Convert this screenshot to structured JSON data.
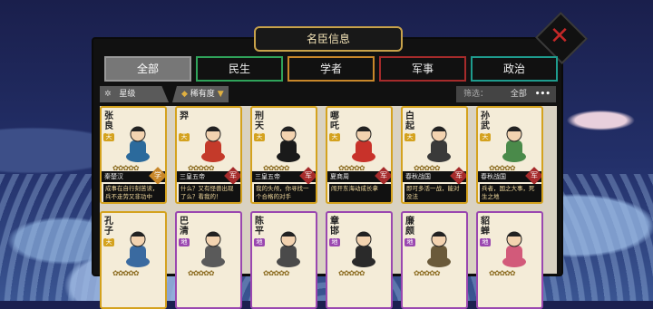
{
  "window": {
    "title": "名臣信息"
  },
  "tabs": [
    {
      "label": "全部",
      "color": "#999999",
      "active": true
    },
    {
      "label": "民生",
      "color": "#2fa35a",
      "active": false
    },
    {
      "label": "学者",
      "color": "#c8872a",
      "active": false
    },
    {
      "label": "军事",
      "color": "#a62b2b",
      "active": false
    },
    {
      "label": "政治",
      "color": "#1e9c8e",
      "active": false
    }
  ],
  "filter": {
    "sort_primary": "星级",
    "sort_secondary": "稀有度",
    "screen_label": "筛选：",
    "screen_value": "全部",
    "more_icon": "more-dots-icon"
  },
  "cards": [
    {
      "name": "张良",
      "badge": "天",
      "badge_color": "#d4a21e",
      "border": "#d4a21e",
      "stars": "✿✿✿✿✿",
      "origin": "秦楚汉",
      "role": "学",
      "role_color": "#c8872a",
      "quote": "成事在自行刻苦读，兵不走劳又非功中"
    },
    {
      "name": "羿",
      "badge": "天",
      "badge_color": "#d4a21e",
      "border": "#d4a21e",
      "stars": "✿✿✿✿✿",
      "origin": "三皇五帝",
      "role": "军",
      "role_color": "#a62b2b",
      "quote": "什么？又有怪兽出现了么？看我的！"
    },
    {
      "name": "刑天",
      "badge": "天",
      "badge_color": "#d4a21e",
      "border": "#d4a21e",
      "stars": "✿✿✿✿✿",
      "origin": "三皇五帝",
      "role": "军",
      "role_color": "#a62b2b",
      "quote": "我的头颅，你寻找一个合格的对手"
    },
    {
      "name": "哪吒",
      "badge": "天",
      "badge_color": "#d4a21e",
      "border": "#d4a21e",
      "stars": "✿✿✿✿✿",
      "origin": "夏商周",
      "role": "军",
      "role_color": "#a62b2b",
      "quote": "闹开东海动成长拿"
    },
    {
      "name": "白起",
      "badge": "天",
      "badge_color": "#d4a21e",
      "border": "#d4a21e",
      "stars": "✿✿✿✿✿",
      "origin": "春秋战国",
      "role": "军",
      "role_color": "#a62b2b",
      "quote": "即可多活一战，能对没法"
    },
    {
      "name": "孙武",
      "badge": "天",
      "badge_color": "#d4a21e",
      "border": "#d4a21e",
      "stars": "✿✿✿✿✿",
      "origin": "春秋战国",
      "role": "军",
      "role_color": "#a62b2b",
      "quote": "兵者，国之大事，死生之地"
    },
    {
      "name": "孔子",
      "badge": "天",
      "badge_color": "#d4a21e",
      "border": "#d4a21e",
      "stars": "✿✿✿✿✿",
      "origin": "",
      "role": "",
      "role_color": "#c8872a",
      "quote": ""
    },
    {
      "name": "巴清",
      "badge": "地",
      "badge_color": "#9a47b0",
      "border": "#9a47b0",
      "stars": "✿✿✿✿✿",
      "origin": "",
      "role": "",
      "role_color": "#2fa35a",
      "quote": ""
    },
    {
      "name": "陈平",
      "badge": "地",
      "badge_color": "#9a47b0",
      "border": "#9a47b0",
      "stars": "✿✿✿✿✿",
      "origin": "",
      "role": "",
      "role_color": "#1e9c8e",
      "quote": ""
    },
    {
      "name": "章邯",
      "badge": "地",
      "badge_color": "#9a47b0",
      "border": "#9a47b0",
      "stars": "✿✿✿✿✿",
      "origin": "",
      "role": "",
      "role_color": "#a62b2b",
      "quote": ""
    },
    {
      "name": "廉颇",
      "badge": "地",
      "badge_color": "#9a47b0",
      "border": "#9a47b0",
      "stars": "✿✿✿✿✿",
      "origin": "",
      "role": "",
      "role_color": "#a62b2b",
      "quote": ""
    },
    {
      "name": "貂蝉",
      "badge": "地",
      "badge_color": "#9a47b0",
      "border": "#9a47b0",
      "stars": "✿✿✿✿✿",
      "origin": "",
      "role": "",
      "role_color": "#1e9c8e",
      "quote": ""
    }
  ]
}
